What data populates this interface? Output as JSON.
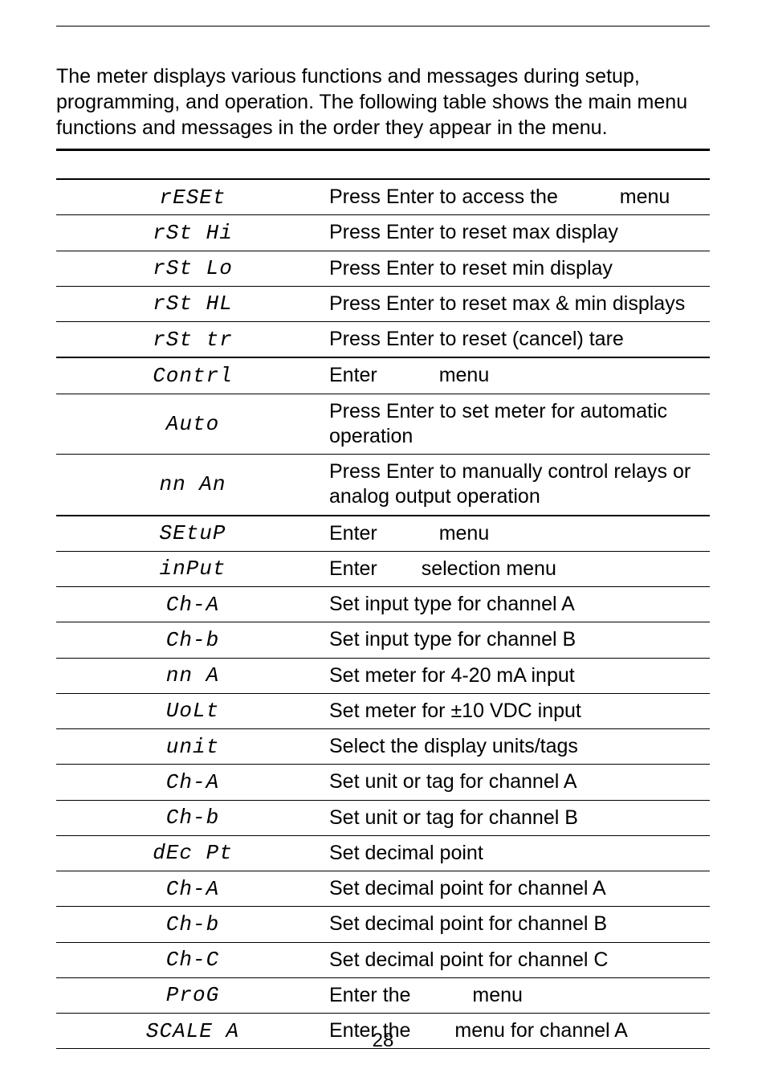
{
  "intro": "The meter displays various functions and messages during setup, programming, and operation. The following table shows the main menu functions and messages in the order they appear in the menu.",
  "rows": [
    {
      "code": "rESEt",
      "desc_pre": "Press Enter to access the ",
      "gap": "gap",
      "desc_post": "menu",
      "border": "top",
      "indent": 0
    },
    {
      "code": "rSt Hi",
      "desc_pre": "Press Enter to reset max display",
      "gap": null,
      "desc_post": "",
      "border": "thin",
      "indent": 1
    },
    {
      "code": "rSt Lo",
      "desc_pre": "Press Enter to reset min display",
      "gap": null,
      "desc_post": "",
      "border": "thin",
      "indent": 1
    },
    {
      "code": "rSt HL",
      "desc_pre": "Press Enter to reset max & min displays",
      "gap": null,
      "desc_post": "",
      "border": "thin",
      "indent": 1
    },
    {
      "code": "rSt tr",
      "desc_pre": "Press Enter to reset (cancel) tare",
      "gap": null,
      "desc_post": "",
      "border": "thin",
      "indent": 1
    },
    {
      "code": "Contrl",
      "desc_pre": "Enter ",
      "gap": "gap",
      "desc_post": "menu",
      "border": "top",
      "indent": 0
    },
    {
      "code": "Auto",
      "desc_pre": "Press Enter to set meter for automatic operation",
      "gap": null,
      "desc_post": "",
      "border": "thin",
      "indent": 1
    },
    {
      "code": "nn An",
      "desc_pre": "Press Enter to manually control relays or analog output operation",
      "gap": null,
      "desc_post": "",
      "border": "thin",
      "indent": 1
    },
    {
      "code": "SEtuP",
      "desc_pre": "Enter ",
      "gap": "gap",
      "desc_post": "menu",
      "border": "top",
      "indent": 0
    },
    {
      "code": "inPut",
      "desc_pre": "Enter ",
      "gap": "gap-sm",
      "desc_post": "selection menu",
      "border": "thin",
      "indent": 1
    },
    {
      "code": "Ch-A",
      "desc_pre": "Set input type for channel A",
      "gap": null,
      "desc_post": "",
      "border": "thin",
      "indent": 2
    },
    {
      "code": "Ch-b",
      "desc_pre": "Set input type for channel B",
      "gap": null,
      "desc_post": "",
      "border": "thin",
      "indent": 2
    },
    {
      "code": "nn A",
      "desc_pre": "Set meter for 4-20 mA input",
      "gap": null,
      "desc_post": "",
      "border": "thin",
      "indent": 2
    },
    {
      "code": "UoLt",
      "desc_pre": "Set meter for ±10 VDC input",
      "gap": null,
      "desc_post": "",
      "border": "thin",
      "indent": 2
    },
    {
      "code": "unit",
      "desc_pre": "Select the display units/tags",
      "gap": null,
      "desc_post": "",
      "border": "thin",
      "indent": 2
    },
    {
      "code": "Ch-A",
      "desc_pre": "Set unit or tag for channel A",
      "gap": null,
      "desc_post": "",
      "border": "thin",
      "indent": 2
    },
    {
      "code": "Ch-b",
      "desc_pre": "Set unit or tag for channel B",
      "gap": null,
      "desc_post": "",
      "border": "thin",
      "indent": 2
    },
    {
      "code": "dEc Pt",
      "desc_pre": "Set decimal point",
      "gap": null,
      "desc_post": "",
      "border": "thin",
      "indent": 1
    },
    {
      "code": "Ch-A",
      "desc_pre": "Set decimal point for channel A",
      "gap": null,
      "desc_post": "",
      "border": "thin",
      "indent": 2
    },
    {
      "code": "Ch-b",
      "desc_pre": "Set decimal point for channel B",
      "gap": null,
      "desc_post": "",
      "border": "thin",
      "indent": 2
    },
    {
      "code": "Ch-C",
      "desc_pre": "Set decimal point for channel C",
      "gap": null,
      "desc_post": "",
      "border": "thin",
      "indent": 2
    },
    {
      "code": "ProG",
      "desc_pre": "Enter the ",
      "gap": "gap",
      "desc_post": "menu",
      "border": "thin",
      "indent": 1
    },
    {
      "code": "SCALE A",
      "desc_pre": "Enter the ",
      "gap": "gap-sm",
      "desc_post": "menu for channel A",
      "border": "thin",
      "indent": 2,
      "last": true
    }
  ],
  "page_number": "28"
}
